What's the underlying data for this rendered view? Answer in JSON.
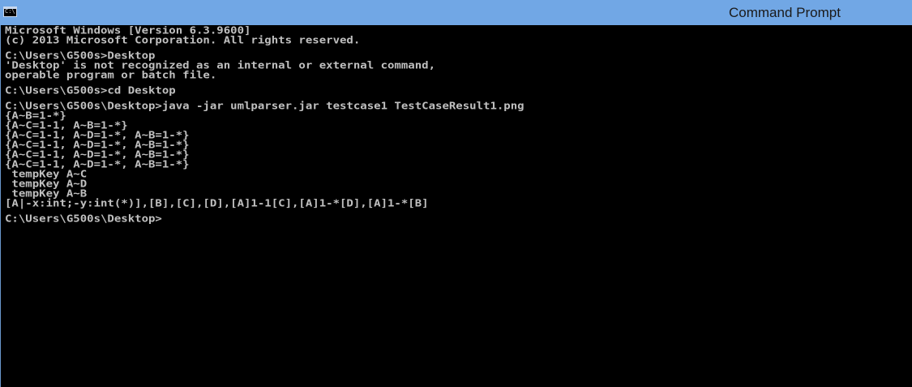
{
  "window": {
    "title": "Command Prompt",
    "icon": "cmd-app-icon",
    "icon_text": "C:\\",
    "colors": {
      "titlebar": "#71a7e5",
      "background": "#000000",
      "text": "#c0c0c0"
    }
  },
  "console": {
    "lines": [
      "Microsoft Windows [Version 6.3.9600]",
      "(c) 2013 Microsoft Corporation. All rights reserved.",
      "",
      "C:\\Users\\G500s>Desktop",
      "'Desktop' is not recognized as an internal or external command,",
      "operable program or batch file.",
      "",
      "C:\\Users\\G500s>cd Desktop",
      "",
      "C:\\Users\\G500s\\Desktop>java -jar umlparser.jar testcase1 TestCaseResult1.png",
      "{A~B=1-*}",
      "{A~C=1-1, A~B=1-*}",
      "{A~C=1-1, A~D=1-*, A~B=1-*}",
      "{A~C=1-1, A~D=1-*, A~B=1-*}",
      "{A~C=1-1, A~D=1-*, A~B=1-*}",
      "{A~C=1-1, A~D=1-*, A~B=1-*}",
      " tempKey A~C",
      " tempKey A~D",
      " tempKey A~B",
      "[A|-x:int;-y:int(*)],[B],[C],[D],[A]1-1[C],[A]1-*[D],[A]1-*[B]",
      "",
      "C:\\Users\\G500s\\Desktop>"
    ]
  }
}
